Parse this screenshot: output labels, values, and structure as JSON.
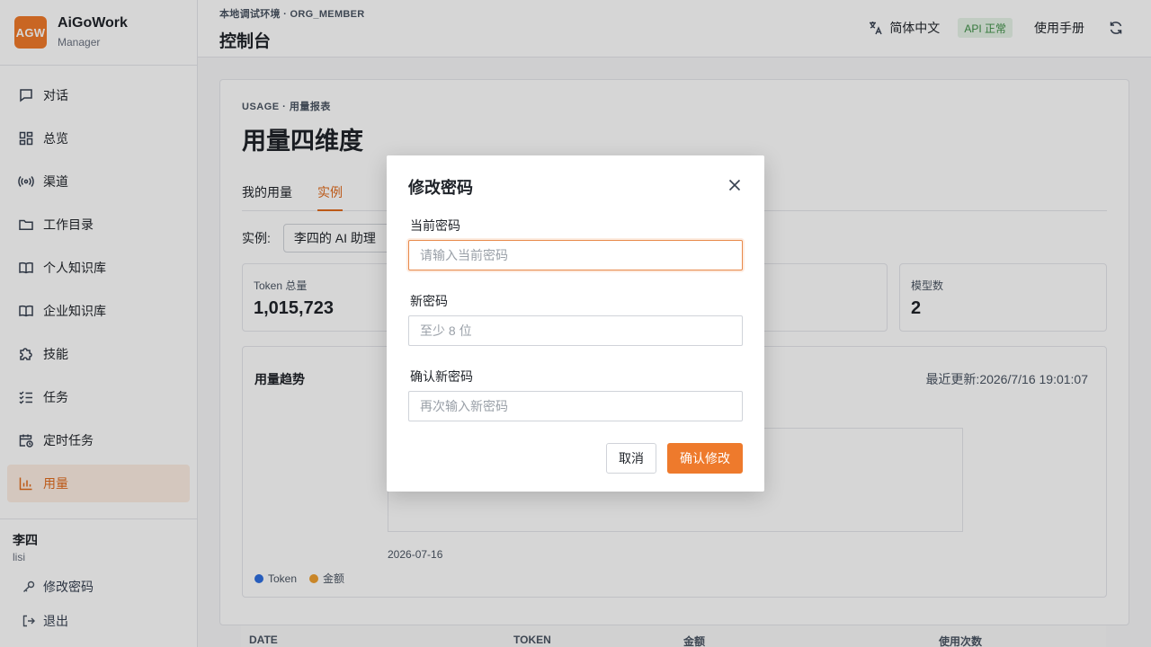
{
  "brand": {
    "logo": "AGW",
    "name": "AiGoWork",
    "sub": "Manager"
  },
  "nav": [
    {
      "label": "对话",
      "icon": "chat-icon"
    },
    {
      "label": "总览",
      "icon": "grid-icon"
    },
    {
      "label": "渠道",
      "icon": "broadcast-icon"
    },
    {
      "label": "工作目录",
      "icon": "folder-icon"
    },
    {
      "label": "个人知识库",
      "icon": "book-icon"
    },
    {
      "label": "企业知识库",
      "icon": "book-icon"
    },
    {
      "label": "技能",
      "icon": "puzzle-icon"
    },
    {
      "label": "任务",
      "icon": "checklist-icon"
    },
    {
      "label": "定时任务",
      "icon": "calendar-clock-icon"
    },
    {
      "label": "用量",
      "icon": "bar-chart-icon",
      "active": true
    }
  ],
  "user": {
    "name": "李四",
    "id": "lisi",
    "change_password": "修改密码",
    "logout": "退出"
  },
  "header": {
    "env": "本地调试环境 · ORG_MEMBER",
    "title": "控制台",
    "lang": "简体中文",
    "api_status": "API 正常",
    "manual": "使用手册"
  },
  "usage": {
    "kicker": "USAGE · 用量报表",
    "title": "用量四维度",
    "tabs": [
      {
        "label": "我的用量"
      },
      {
        "label": "实例",
        "active": true
      }
    ],
    "instance_label": "实例:",
    "instance_value": "李四的 AI 助理",
    "stats": [
      {
        "label": "Token 总量",
        "value": "1,015,723"
      },
      {
        "label": "模型数",
        "value": "2"
      }
    ],
    "chart": {
      "title": "用量趋势",
      "updated": "最近更新:2026/7/16 19:01:07",
      "x_tick": "2026-07-16",
      "legend": [
        {
          "name": "Token",
          "color": "#2f6fe0"
        },
        {
          "name": "金额",
          "color": "#f0a030"
        }
      ]
    },
    "table_headers": [
      "DATE",
      "TOKEN",
      "金额",
      "使用次数"
    ]
  },
  "modal": {
    "title": "修改密码",
    "current_label": "当前密码",
    "current_placeholder": "请输入当前密码",
    "new_label": "新密码",
    "new_placeholder": "至少 8 位",
    "confirm_label": "确认新密码",
    "confirm_placeholder": "再次输入新密码",
    "cancel": "取消",
    "submit": "确认修改"
  }
}
